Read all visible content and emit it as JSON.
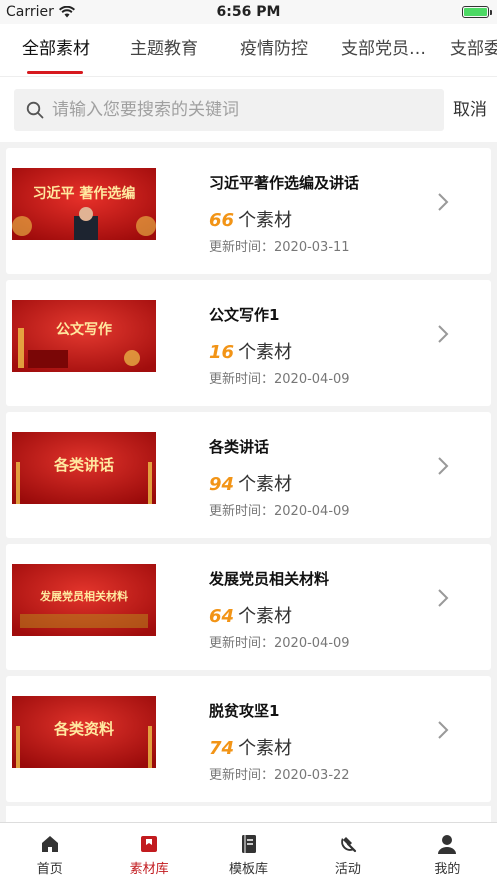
{
  "status_bar": {
    "carrier": "Carrier",
    "time": "6:56 PM"
  },
  "tabs": [
    {
      "label": "全部素材",
      "active": true
    },
    {
      "label": "主题教育",
      "active": false
    },
    {
      "label": "疫情防控",
      "active": false
    },
    {
      "label": "支部党员…",
      "active": false
    },
    {
      "label": "支部委",
      "active": false
    }
  ],
  "search": {
    "placeholder": "请输入您要搜索的关键词",
    "value": "",
    "cancel_label": "取消"
  },
  "items": [
    {
      "title": "习近平著作选编及讲话",
      "count": "66",
      "count_suffix": "个素材",
      "updated": "更新时间：2020-03-11",
      "thumb_text": "习近平 著作选编"
    },
    {
      "title": "公文写作1",
      "count": "16",
      "count_suffix": "个素材",
      "updated": "更新时间：2020-04-09",
      "thumb_text": "公文写作"
    },
    {
      "title": "各类讲话",
      "count": "94",
      "count_suffix": "个素材",
      "updated": "更新时间：2020-04-09",
      "thumb_text": "各类讲话"
    },
    {
      "title": "发展党员相关材料",
      "count": "64",
      "count_suffix": "个素材",
      "updated": "更新时间：2020-04-09",
      "thumb_text": "发展党员相关材料"
    },
    {
      "title": "脱贫攻坚1",
      "count": "74",
      "count_suffix": "个素材",
      "updated": "更新时间：2020-03-22",
      "thumb_text": "各类资料"
    }
  ],
  "bottom_nav": [
    {
      "label": "首页",
      "icon": "home-icon",
      "active": false
    },
    {
      "label": "素材库",
      "icon": "library-icon",
      "active": true
    },
    {
      "label": "模板库",
      "icon": "template-icon",
      "active": false
    },
    {
      "label": "活动",
      "icon": "activity-icon",
      "active": false
    },
    {
      "label": "我的",
      "icon": "profile-icon",
      "active": false
    }
  ],
  "colors": {
    "accent": "#d7191e",
    "count": "#f29416",
    "nav_active": "#c21b1f"
  }
}
